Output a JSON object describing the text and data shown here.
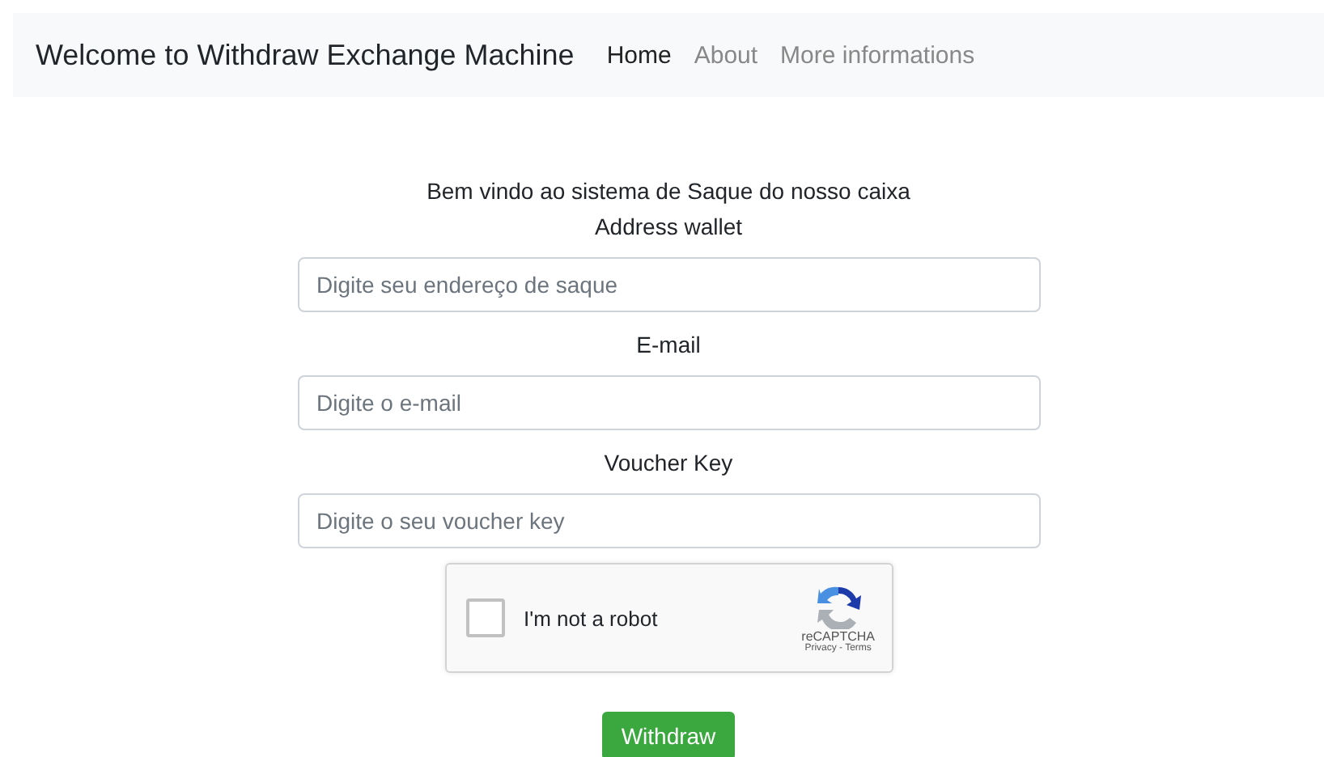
{
  "navbar": {
    "brand": "Welcome to Withdraw Exchange Machine",
    "items": [
      {
        "label": "Home",
        "selected": true
      },
      {
        "label": "About",
        "selected": false
      },
      {
        "label": "More informations",
        "selected": false
      }
    ]
  },
  "form": {
    "intro": "Bem vindo ao sistema de Saque do nosso caixa",
    "fields": [
      {
        "label": "Address wallet",
        "placeholder": "Digite seu endereço de saque"
      },
      {
        "label": "E-mail",
        "placeholder": "Digite o e-mail"
      },
      {
        "label": "Voucher Key",
        "placeholder": "Digite o seu voucher key"
      }
    ],
    "captcha": {
      "label": "I'm not a robot",
      "checked": false,
      "brand": "reCAPTCHA",
      "links": "Privacy - Terms"
    },
    "submit": "Withdraw"
  }
}
